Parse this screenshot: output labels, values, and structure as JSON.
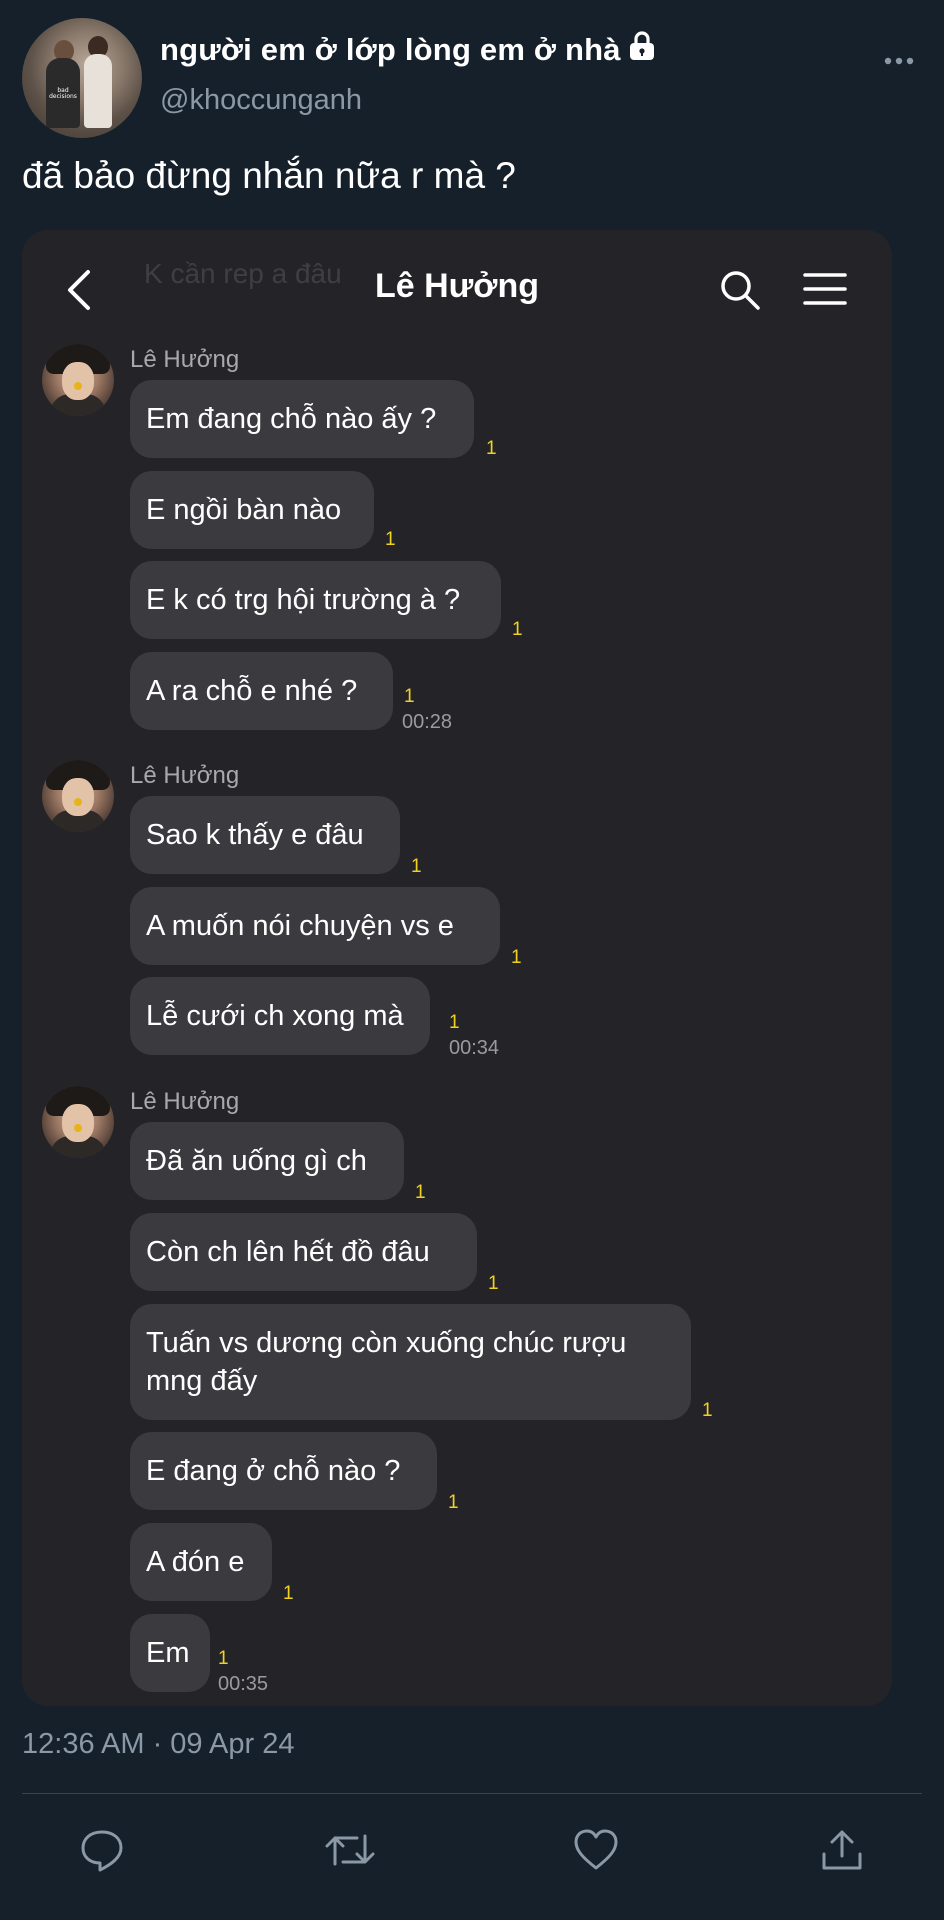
{
  "tweet": {
    "display_name": "người em ở lớp lòng em ở nhà",
    "handle": "@khoccunganh",
    "text": "đã bảo đừng nhắn nữa r mà ?",
    "timestamp": "12:36 AM · 09 Apr 24",
    "avatar_shirt_text": "bad decisions",
    "lock_icon": "lock-icon",
    "more_icon": "more-horizontal-icon"
  },
  "chat": {
    "ghost_text": "K cần rep a đâu",
    "title": "Lê Hưởng",
    "groups": [
      {
        "sender": "Lê Hưởng",
        "messages": [
          {
            "text": "Em đang chỗ nào ấy ?",
            "unread": "1"
          },
          {
            "text": "E ngồi bàn nào",
            "unread": "1"
          },
          {
            "text": "E k có trg hội trường à ?",
            "unread": "1"
          },
          {
            "text": "A ra chỗ e nhé ?",
            "unread": "1",
            "time": "00:28"
          }
        ]
      },
      {
        "sender": "Lê Hưởng",
        "messages": [
          {
            "text": "Sao k thấy e đâu",
            "unread": "1"
          },
          {
            "text": "A muốn nói chuyện vs e",
            "unread": "1"
          },
          {
            "text": "Lễ cưới ch xong mà",
            "unread": "1",
            "time": "00:34"
          }
        ]
      },
      {
        "sender": "Lê Hưởng",
        "messages": [
          {
            "text": "Đã ăn uống gì ch",
            "unread": "1"
          },
          {
            "text": "Còn ch lên hết đồ đâu",
            "unread": "1"
          },
          {
            "text": "Tuấn vs dương còn xuống chúc rượu mng đấy",
            "unread": "1"
          },
          {
            "text": "E đang ở chỗ nào ?",
            "unread": "1"
          },
          {
            "text": "A đón e",
            "unread": "1"
          },
          {
            "text": "Em",
            "unread": "1",
            "time": "00:35"
          }
        ]
      }
    ]
  },
  "actions": {
    "reply": "reply-icon",
    "retweet": "retweet-icon",
    "like": "heart-icon",
    "share": "share-icon"
  },
  "colors": {
    "background": "#15202b",
    "secondary_text": "#8b98a5",
    "chat_background": "#242428",
    "bubble": "#3b3b3f",
    "unread_count": "#f0d21f"
  }
}
